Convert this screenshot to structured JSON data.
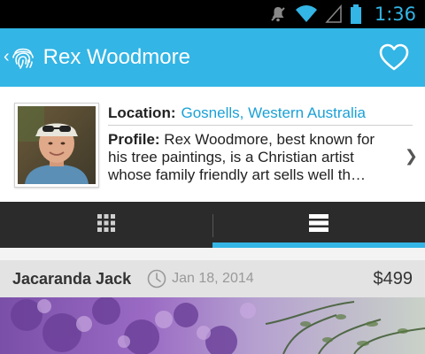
{
  "status_bar": {
    "time": "1:36",
    "icons": [
      "mute-icon",
      "wifi-icon",
      "signal-icon",
      "battery-icon"
    ],
    "accent": "#33b5e5"
  },
  "action_bar": {
    "title": "Rex Woodmore",
    "app_icon": "fingerprint-icon",
    "action_icon": "heart-icon",
    "color": "#33b5e5"
  },
  "profile": {
    "location_label": "Location:",
    "location_value": "Gosnells, Western Australia",
    "profile_label": "Profile:",
    "profile_line1": " Rex Woodmore, best known for",
    "profile_line2": "his tree paintings, is a Christian artist",
    "profile_line3": "whose family friendly art sells well th…",
    "link_color": "#1aa1d6"
  },
  "tabs": [
    {
      "icon": "grid-view-icon",
      "active": false
    },
    {
      "icon": "list-view-icon",
      "active": true
    }
  ],
  "item": {
    "title": "Jacaranda Jack",
    "date": "Jan 18, 2014",
    "price": "$499"
  }
}
